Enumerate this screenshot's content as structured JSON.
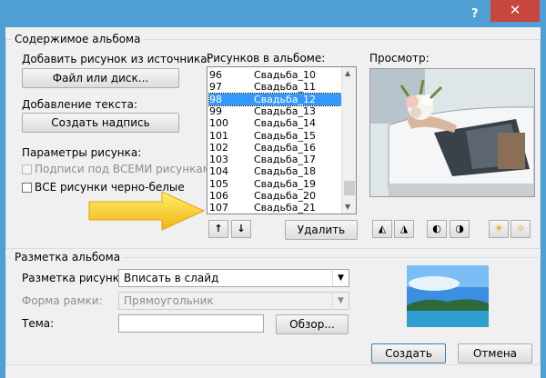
{
  "titlebar": {
    "help": "?",
    "close": "✕"
  },
  "album_content": {
    "legend": "Содержимое альбома",
    "add_from_label": "Добавить рисунок из источника:",
    "file_button": "Файл или диск...",
    "add_text_label": "Добавление текста:",
    "create_caption_button": "Создать надпись",
    "picture_options_label": "Параметры рисунка:",
    "captions_all": "Подписи под ВСЕМИ рисунками",
    "all_bw": "ВСЕ рисунки черно-белые",
    "pictures_label": "Рисунков в альбоме:",
    "pictures": [
      {
        "num": "96",
        "name": "Свадьба_10"
      },
      {
        "num": "97",
        "name": "Свадьба_11"
      },
      {
        "num": "98",
        "name": "Свадьба_12"
      },
      {
        "num": "99",
        "name": "Свадьба_13"
      },
      {
        "num": "100",
        "name": "Свадьба_14"
      },
      {
        "num": "101",
        "name": "Свадьба_15"
      },
      {
        "num": "102",
        "name": "Свадьба_16"
      },
      {
        "num": "103",
        "name": "Свадьба_17"
      },
      {
        "num": "104",
        "name": "Свадьба_18"
      },
      {
        "num": "105",
        "name": "Свадьба_19"
      },
      {
        "num": "106",
        "name": "Свадьба_20"
      },
      {
        "num": "107",
        "name": "Свадьба_21"
      }
    ],
    "selected_index": 2,
    "remove_button": "Удалить",
    "preview_label": "Просмотр:"
  },
  "album_layout": {
    "legend": "Разметка альбома",
    "picture_layout_label": "Разметка рисунка:",
    "picture_layout_value": "Вписать в слайд",
    "frame_shape_label": "Форма рамки:",
    "frame_shape_value": "Прямоугольник",
    "theme_label": "Тема:",
    "theme_value": "",
    "browse_button": "Обзор..."
  },
  "footer": {
    "create_button": "Создать",
    "cancel_button": "Отмена"
  },
  "colors": {
    "title_bar": "#4f9fd5",
    "close": "#c7463e",
    "selection": "#3399ff",
    "arrow": "#f7d41c"
  }
}
